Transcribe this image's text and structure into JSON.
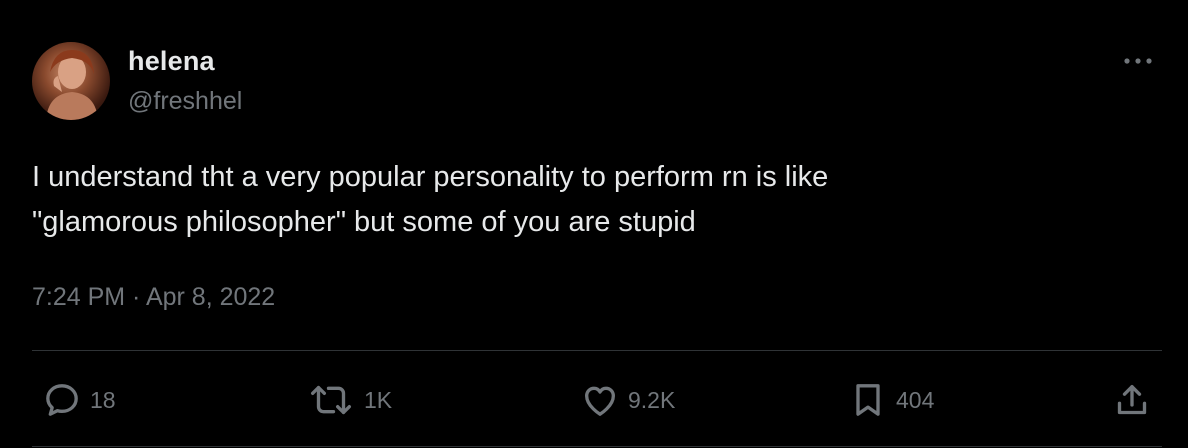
{
  "author": {
    "display_name": "helena",
    "handle": "@freshhel"
  },
  "tweet": {
    "text_lines": [
      "I understand tht a very popular personality to perform rn is like",
      "\"glamorous philosopher\" but some of you are stupid"
    ],
    "timestamp": "7:24 PM · Apr 8, 2022"
  },
  "actions": {
    "reply": {
      "icon": "reply-icon",
      "count": "18"
    },
    "retweet": {
      "icon": "retweet-icon",
      "count": "1K"
    },
    "like": {
      "icon": "heart-icon",
      "count": "9.2K"
    },
    "bookmark": {
      "icon": "bookmark-icon",
      "count": "404"
    },
    "share": {
      "icon": "share-icon"
    }
  },
  "colors": {
    "background": "#000000",
    "text": "#e7e9ea",
    "secondary": "#71767b",
    "divider": "#2f3336"
  }
}
